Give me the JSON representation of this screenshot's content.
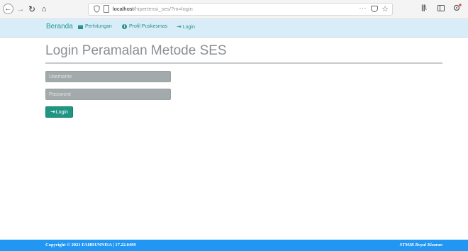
{
  "browser": {
    "url_host": "localhost",
    "url_path": "/hipertensi_ses/?m=login",
    "more_label": "···"
  },
  "navbar": {
    "brand": "Beranda",
    "items": [
      {
        "label": "Perhitungan",
        "icon": "table-icon"
      },
      {
        "label": "Profil Puskesmas",
        "icon": "info-icon"
      },
      {
        "label": "Login",
        "icon": "login-icon"
      }
    ]
  },
  "main": {
    "title": "Login Peramalan Metode SES",
    "username_placeholder": "Username",
    "password_placeholder": "Password",
    "login_label": "Login"
  },
  "footer": {
    "copyright": "Copyright © 2021 FAHRUNNISA | 17.22.0499",
    "org": "STMIK Royal Kisaran"
  },
  "colors": {
    "navbar_bg": "#d8edf8",
    "accent": "#1f9683",
    "footer_bg": "#2196f3"
  }
}
